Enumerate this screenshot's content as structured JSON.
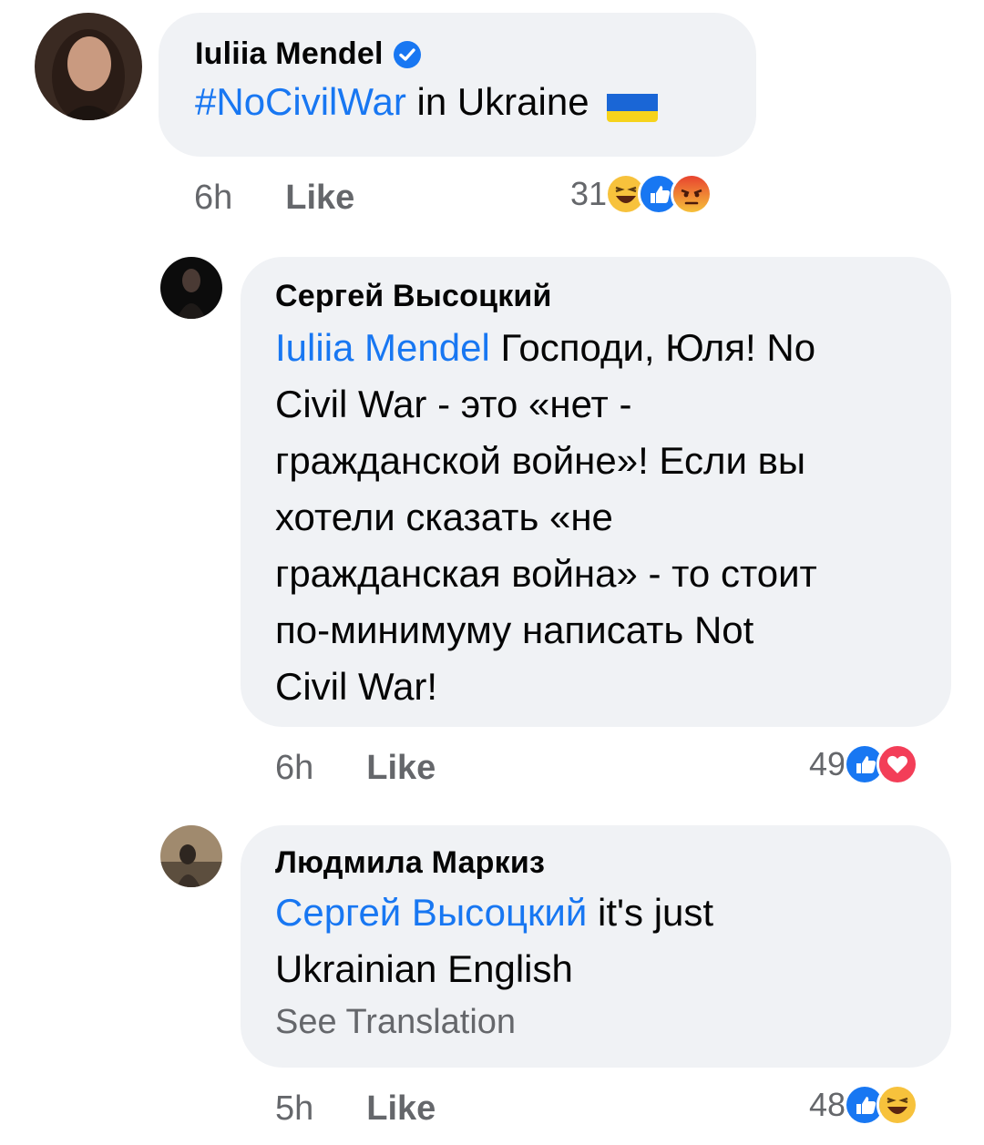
{
  "comments": [
    {
      "author": "Iuliia Mendel",
      "verified": true,
      "hashtag": "#NoCivilWar",
      "text": "in Ukraine",
      "flag_icon": "ukraine-flag-emoji",
      "time": "6h",
      "like_label": "Like",
      "reaction_count": "31",
      "reactions": [
        "haha",
        "like",
        "angry"
      ]
    },
    {
      "author": "Сергей Высоцкий",
      "mention": "Iuliia Mendel",
      "lines_after_mention": "Господи, Юля! No",
      "text_lines": [
        "Civil War - это «нет -",
        "гражданской войне»! Если вы",
        "хотели сказать «не",
        "гражданская война» - то стоит",
        "по-минимуму написать Not",
        "Civil War!"
      ],
      "time": "6h",
      "like_label": "Like",
      "reaction_count": "49",
      "reactions": [
        "like",
        "love"
      ]
    },
    {
      "author": "Людмила Маркиз",
      "mention": "Сергей Высоцкий",
      "after_mention": "it's just",
      "text_line2": "Ukrainian English",
      "see_translation": "See Translation",
      "time": "5h",
      "like_label": "Like",
      "reaction_count": "48",
      "reactions": [
        "like",
        "haha"
      ]
    }
  ],
  "colors": {
    "link": "#1877f2",
    "bubble": "#f0f2f5",
    "meta_text": "#65676b"
  }
}
